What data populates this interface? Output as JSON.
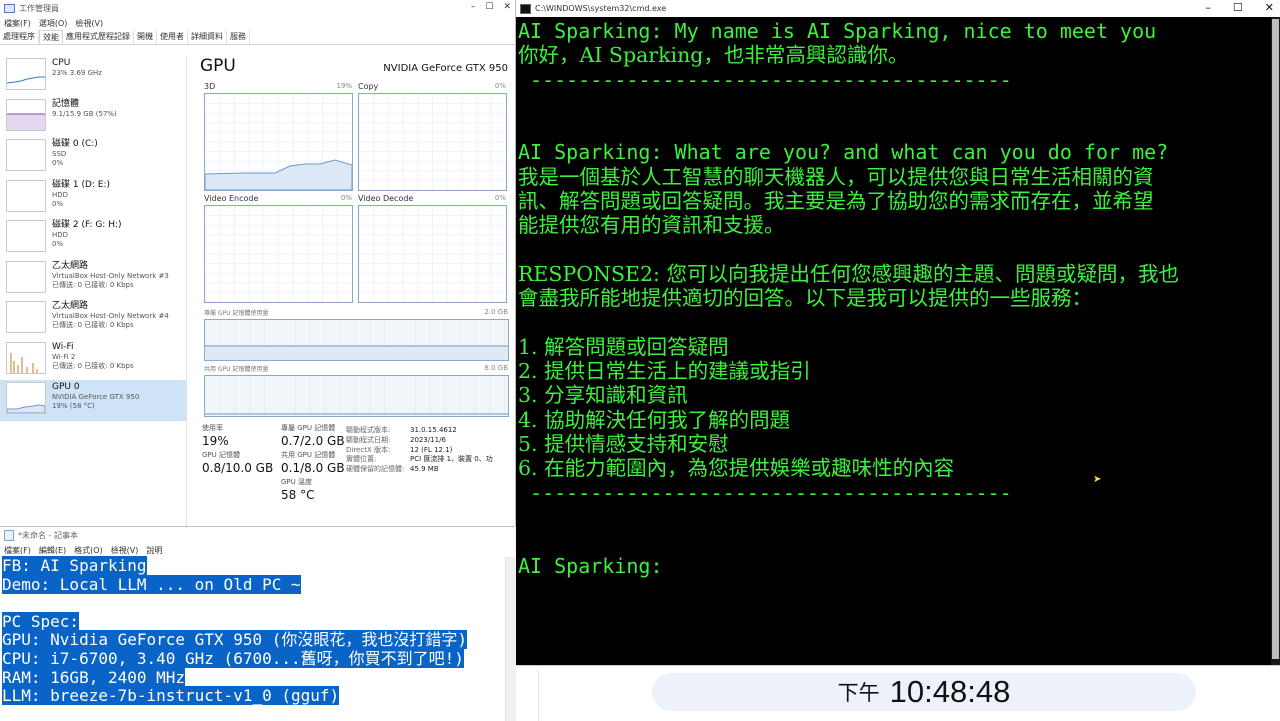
{
  "task_manager": {
    "title": "工作管理員",
    "menu": [
      "檔案(F)",
      "選項(O)",
      "檢視(V)"
    ],
    "tabs": [
      "處理程序",
      "效能",
      "應用程式歷程記錄",
      "開機",
      "使用者",
      "詳細資料",
      "服務"
    ],
    "active_tab": "效能",
    "resources": [
      {
        "name": "CPU",
        "line1": "23%  3.69 GHz",
        "line2": "",
        "icon": "cpu-graph"
      },
      {
        "name": "記憶體",
        "line1": "9.1/15.9 GB (57%)",
        "line2": "",
        "icon": "memory-graph"
      },
      {
        "name": "磁碟 0 (C:)",
        "line1": "SSD",
        "line2": "0%",
        "icon": "disk-graph"
      },
      {
        "name": "磁碟 1 (D: E:)",
        "line1": "HDD",
        "line2": "0%",
        "icon": "disk-graph"
      },
      {
        "name": "磁碟 2 (F: G: H:)",
        "line1": "HDD",
        "line2": "0%",
        "icon": "disk-graph"
      },
      {
        "name": "乙太網路",
        "line1": "VirtualBox Host-Only Network #3",
        "line2": "已傳送: 0 已接收: 0 Kbps",
        "icon": "ethernet-graph"
      },
      {
        "name": "乙太網路",
        "line1": "VirtualBox Host-Only Network #4",
        "line2": "已傳送: 0 已接收: 0 Kbps",
        "icon": "ethernet-graph"
      },
      {
        "name": "Wi-Fi",
        "line1": "Wi-Fi 2",
        "line2": "已傳送: 0 已接收: 0 Kbps",
        "icon": "wifi-graph"
      },
      {
        "name": "GPU 0",
        "line1": "NVIDIA GeForce GTX 950",
        "line2": "19% (58 °C)",
        "icon": "gpu-graph"
      }
    ],
    "selected_resource": 8,
    "gpu": {
      "title": "GPU",
      "model": "NVIDIA GeForce GTX 950",
      "engines": [
        {
          "name": "3D",
          "pct": "19%"
        },
        {
          "name": "Copy",
          "pct": "0%"
        },
        {
          "name": "Video Encode",
          "pct": "0%"
        },
        {
          "name": "Video Decode",
          "pct": "0%"
        }
      ],
      "dedicated_label": "專屬 GPU 記憶體使用量",
      "dedicated_max": "2.0 GB",
      "shared_label": "共用 GPU 記憶體使用量",
      "shared_max": "8.0 GB",
      "stats": [
        {
          "label": "使用率",
          "value": "19%"
        },
        {
          "label": "GPU 記憶體",
          "value": "0.8/10.0 GB"
        },
        {
          "label": "專屬 GPU 記憶體",
          "value": "0.7/2.0 GB"
        },
        {
          "label": "共用 GPU 記憶體",
          "value": "0.1/8.0 GB"
        },
        {
          "label": "GPU 溫度",
          "value": "58 °C"
        }
      ],
      "properties": [
        {
          "k": "驅動程式版本:",
          "v": "31.0.15.4612"
        },
        {
          "k": "驅動程式日期:",
          "v": "2023/11/6"
        },
        {
          "k": "DirectX 版本:",
          "v": "12 (FL 12.1)"
        },
        {
          "k": "實體位置:",
          "v": "PCI 匯流排 1、裝置 0、功"
        },
        {
          "k": "硬體保留的記憶體:",
          "v": "45.9 MB"
        }
      ]
    }
  },
  "notepad": {
    "title": "*未命名 - 記事本",
    "menu": [
      "檔案(F)",
      "編輯(E)",
      "格式(O)",
      "檢視(V)",
      "說明"
    ],
    "lines": [
      "FB: AI Sparking",
      "Demo: Local LLM ... on Old PC ~",
      "",
      "PC Spec:",
      "GPU: Nvidia GeForce GTX 950 (你沒眼花，我也沒打錯字)",
      "CPU: i7-6700, 3.40 GHz (6700...舊呀，你買不到了吧!)",
      "RAM: 16GB, 2400 MHz",
      "LLM: breeze-7b-instruct-v1_0 (gguf)"
    ]
  },
  "cmd": {
    "title": "C:\\WINDOWS\\system32\\cmd.exe",
    "lines": [
      "AI Sparking: My name is AI Sparking, nice to meet you",
      "你好，AI Sparking，也非常高興認識你。",
      " ----------------------------------------",
      "",
      "",
      "AI Sparking: What are you? and what can you do for me?",
      "我是一個基於人工智慧的聊天機器人，可以提供您與日常生活相關的資",
      "訊、解答問題或回答疑問。我主要是為了協助您的需求而存在，並希望",
      "能提供您有用的資訊和支援。",
      "",
      "RESPONSE2: 您可以向我提出任何您感興趣的主題、問題或疑問，我也",
      "會盡我所能地提供適切的回答。以下是我可以提供的一些服務：",
      "",
      "1. 解答問題或回答疑問",
      "2. 提供日常生活上的建議或指引",
      "3. 分享知識和資訊",
      "4. 協助解決任何我了解的問題",
      "5. 提供情感支持和安慰",
      "6. 在能力範圍內，為您提供娛樂或趣味性的內容",
      " ----------------------------------------",
      "",
      "",
      "AI Sparking:"
    ],
    "text_color": "#3df03d"
  },
  "clock": {
    "period": "下午",
    "time": "10:48:48"
  }
}
